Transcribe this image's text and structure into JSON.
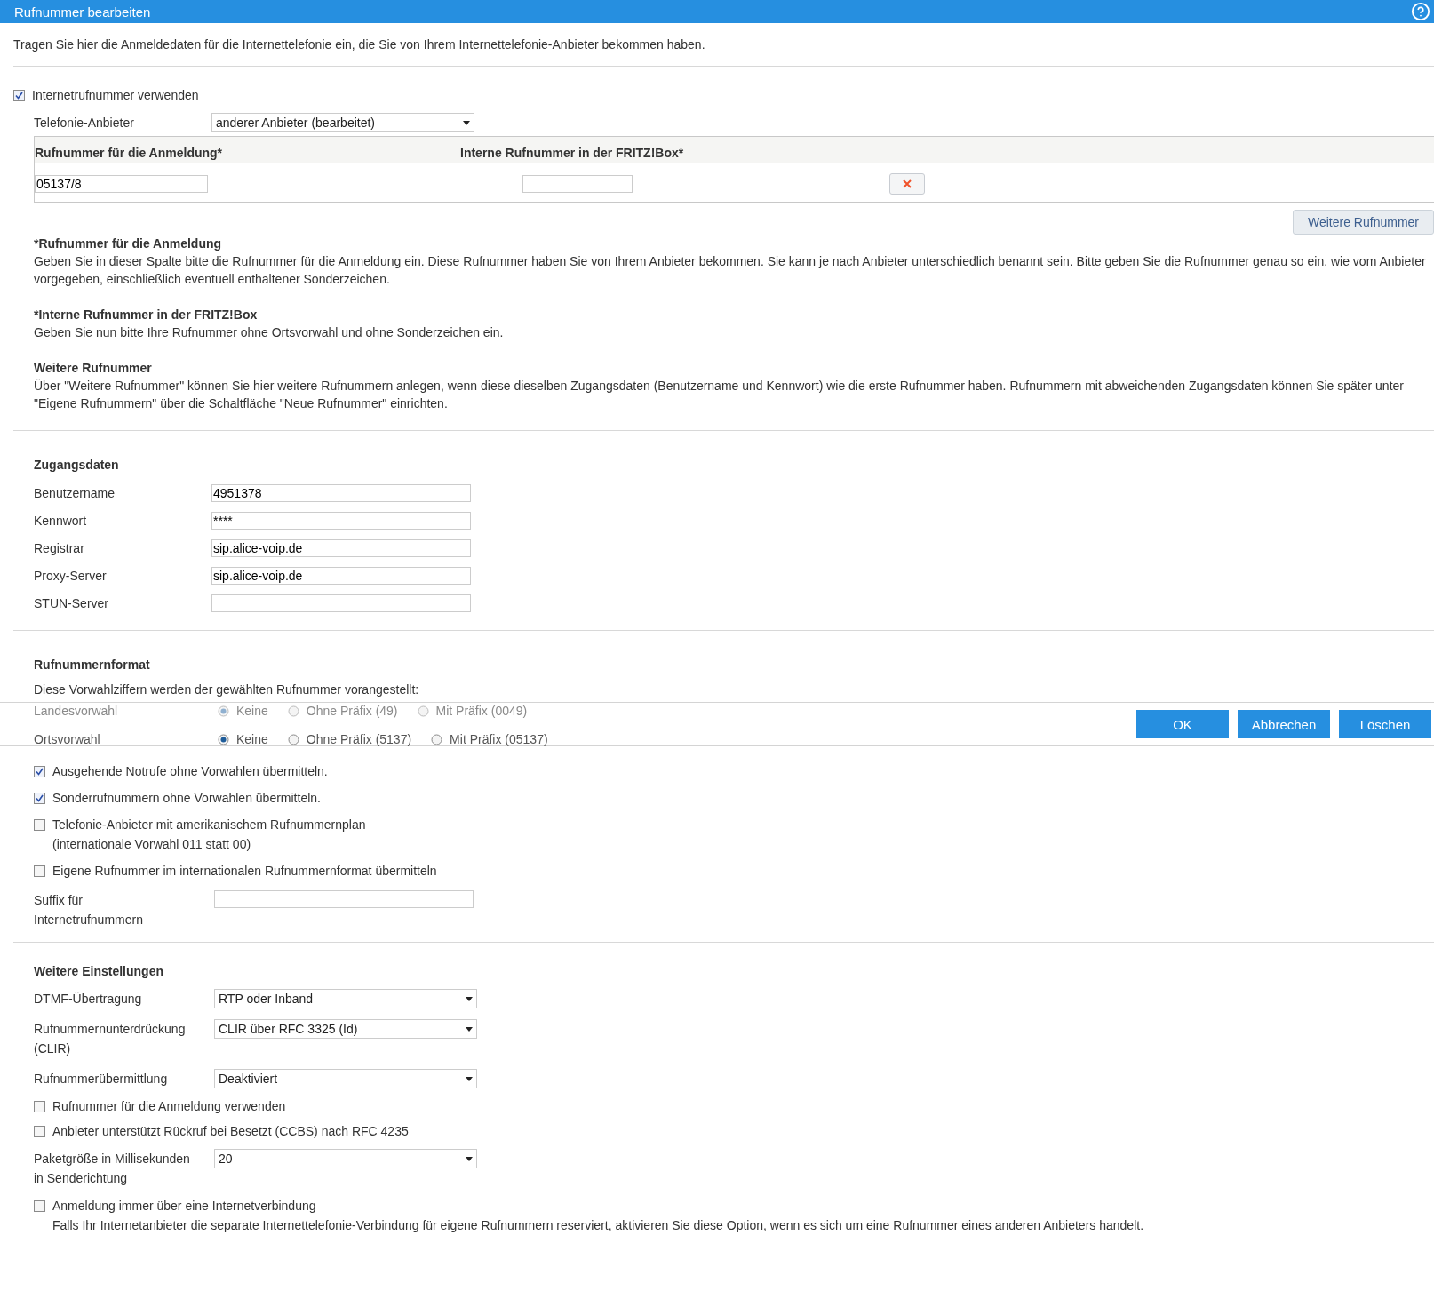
{
  "dialog": {
    "title": "Rufnummer bearbeiten"
  },
  "intro": "Tragen Sie hier die Anmeldedaten für die Internettelefonie ein, die Sie von Ihrem Internettelefonie-Anbieter bekommen haben.",
  "use_internet_number": {
    "label": "Internetrufnummer verwenden",
    "checked": true
  },
  "provider": {
    "label": "Telefonie-Anbieter",
    "value": "anderer Anbieter (bearbeitet)"
  },
  "number_table": {
    "columns": [
      "Rufnummer für die Anmeldung*",
      "Interne Rufnummer in der FRITZ!Box*"
    ],
    "rows": [
      {
        "login_number": "05137/8"
      }
    ]
  },
  "add_button": "Weitere Rufnummer",
  "help": [
    {
      "title": "*Rufnummer für die Anmeldung",
      "text": "Geben Sie in dieser Spalte bitte die Rufnummer für die Anmeldung ein. Diese Rufnummer haben Sie von Ihrem Anbieter bekommen. Sie kann je nach Anbieter unterschiedlich benannt sein. Bitte geben Sie die Rufnummer genau so ein, wie vom Anbieter vorgegeben, einschließlich eventuell enthaltener Sonderzeichen."
    },
    {
      "title": "*Interne Rufnummer in der FRITZ!Box",
      "text": "Geben Sie nun bitte Ihre Rufnummer ohne Ortsvorwahl und ohne Sonderzeichen ein."
    },
    {
      "title": "Weitere Rufnummer",
      "text": "Über \"Weitere Rufnummer\" können Sie hier weitere Rufnummern anlegen, wenn diese dieselben Zugangsdaten (Benutzername und Kennwort) wie die erste Rufnummer haben. Rufnummern mit abweichenden Zugangsdaten können Sie später unter \"Eigene Rufnummern\" über die Schaltfläche \"Neue Rufnummer\" einrichten."
    }
  ],
  "access": {
    "title": "Zugangsdaten",
    "fields": [
      {
        "label": "Benutzername",
        "value": "4951378"
      },
      {
        "label": "Kennwort",
        "value": "****"
      },
      {
        "label": "Registrar",
        "value": "sip.alice-voip.de"
      },
      {
        "label": "Proxy-Server",
        "value": "sip.alice-voip.de"
      },
      {
        "label": "STUN-Server"
      }
    ]
  },
  "format": {
    "title": "Rufnummernformat",
    "intro": "Diese Vorwahlziffern werden der gewählten Rufnummer vorangestellt:",
    "prefix_rows": [
      {
        "label": "Landesvorwahl",
        "disabled": true,
        "options": [
          {
            "label": "Keine",
            "selected": true
          },
          {
            "label": "Ohne Präfix (49)",
            "selected": false
          },
          {
            "label": "Mit Präfix (0049)",
            "selected": false
          }
        ]
      },
      {
        "label": "Ortsvorwahl",
        "disabled": false,
        "options": [
          {
            "label": "Keine",
            "selected": true
          },
          {
            "label": "Ohne Präfix (5137)",
            "selected": false
          },
          {
            "label": "Mit Präfix (05137)",
            "selected": false
          }
        ]
      }
    ],
    "items": [
      {
        "kind": "checkbox",
        "label": "Ausgehende Notrufe ohne Vorwahlen übermitteln.",
        "checked": true
      },
      {
        "kind": "checkbox",
        "label": "Sonderrufnummern ohne Vorwahlen übermitteln.",
        "checked": true
      },
      {
        "kind": "checkbox",
        "label": "Telefonie-Anbieter mit amerikanischem Rufnummernplan",
        "checked": false,
        "note": "(internationale Vorwahl 011 statt 00)"
      },
      {
        "kind": "checkbox",
        "label": "Eigene Rufnummer im internationalen Rufnummernformat übermitteln",
        "checked": false
      },
      {
        "kind": "input",
        "label": "Suffix für Internetrufnummern"
      }
    ]
  },
  "advanced": {
    "title": "Weitere Einstellungen",
    "items": [
      {
        "kind": "select",
        "label": "DTMF-Übertragung",
        "value": "RTP oder Inband"
      },
      {
        "kind": "select",
        "label": "Rufnummernunterdrückung (CLIR)",
        "value": "CLIR über RFC 3325 (Id)"
      },
      {
        "kind": "select",
        "label": "Rufnummerübermittlung",
        "value": "Deaktiviert"
      },
      {
        "kind": "checkbox",
        "label": "Rufnummer für die Anmeldung verwenden",
        "checked": false
      },
      {
        "kind": "checkbox",
        "label": "Anbieter unterstützt Rückruf bei Besetzt (CCBS) nach RFC 4235",
        "checked": false
      },
      {
        "kind": "select",
        "label": "Paketgröße in Millisekunden in Senderichtung",
        "value": "20"
      },
      {
        "kind": "checkbox",
        "label": "Anmeldung immer über eine Internetverbindung",
        "checked": false,
        "note": "Falls Ihr Internetanbieter die separate Internettelefonie-Verbindung für eigene Rufnummern reserviert, aktivieren Sie diese Option, wenn es sich um eine Rufnummer eines anderen Anbieters handelt."
      }
    ]
  },
  "footer_buttons": [
    "OK",
    "Abbrechen",
    "Löschen"
  ]
}
